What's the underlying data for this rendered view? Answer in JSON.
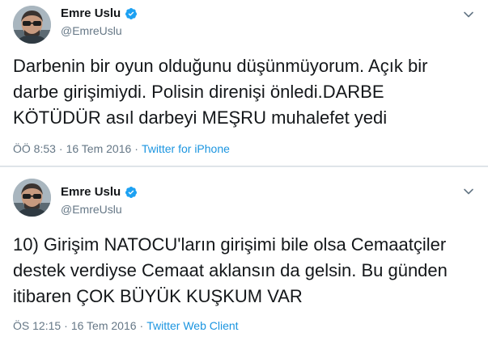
{
  "colors": {
    "link": "#1b95e0",
    "muted": "#657786",
    "verified": "#1da1f2",
    "text": "#14171a"
  },
  "tweets": [
    {
      "display_name": "Emre Uslu",
      "handle": "@EmreUslu",
      "verified_icon": "verified-badge-icon",
      "text": "Darbenin bir oyun olduğunu düşünmüyorum. Açık bir\ndarbe girişimiydi. Polisin direnişi önledi.DARBE\nKÖTÜDÜR asıl darbeyi MEŞRU muhalefet yedi",
      "time": "ÖÖ 8:53",
      "separator1": "·",
      "date": "16 Tem 2016",
      "separator2": "·",
      "source": "Twitter for iPhone"
    },
    {
      "display_name": "Emre Uslu",
      "handle": "@EmreUslu",
      "verified_icon": "verified-badge-icon",
      "text": "10) Girişim NATOCU'ların girişimi bile olsa Cemaatçiler\ndestek verdiyse Cemaat aklansın da gelsin. Bu günden\nitibaren ÇOK BÜYÜK KUŞKUM VAR",
      "time": "ÖS 12:15",
      "separator1": "·",
      "date": "16 Tem 2016",
      "separator2": "·",
      "source": "Twitter Web Client"
    }
  ]
}
